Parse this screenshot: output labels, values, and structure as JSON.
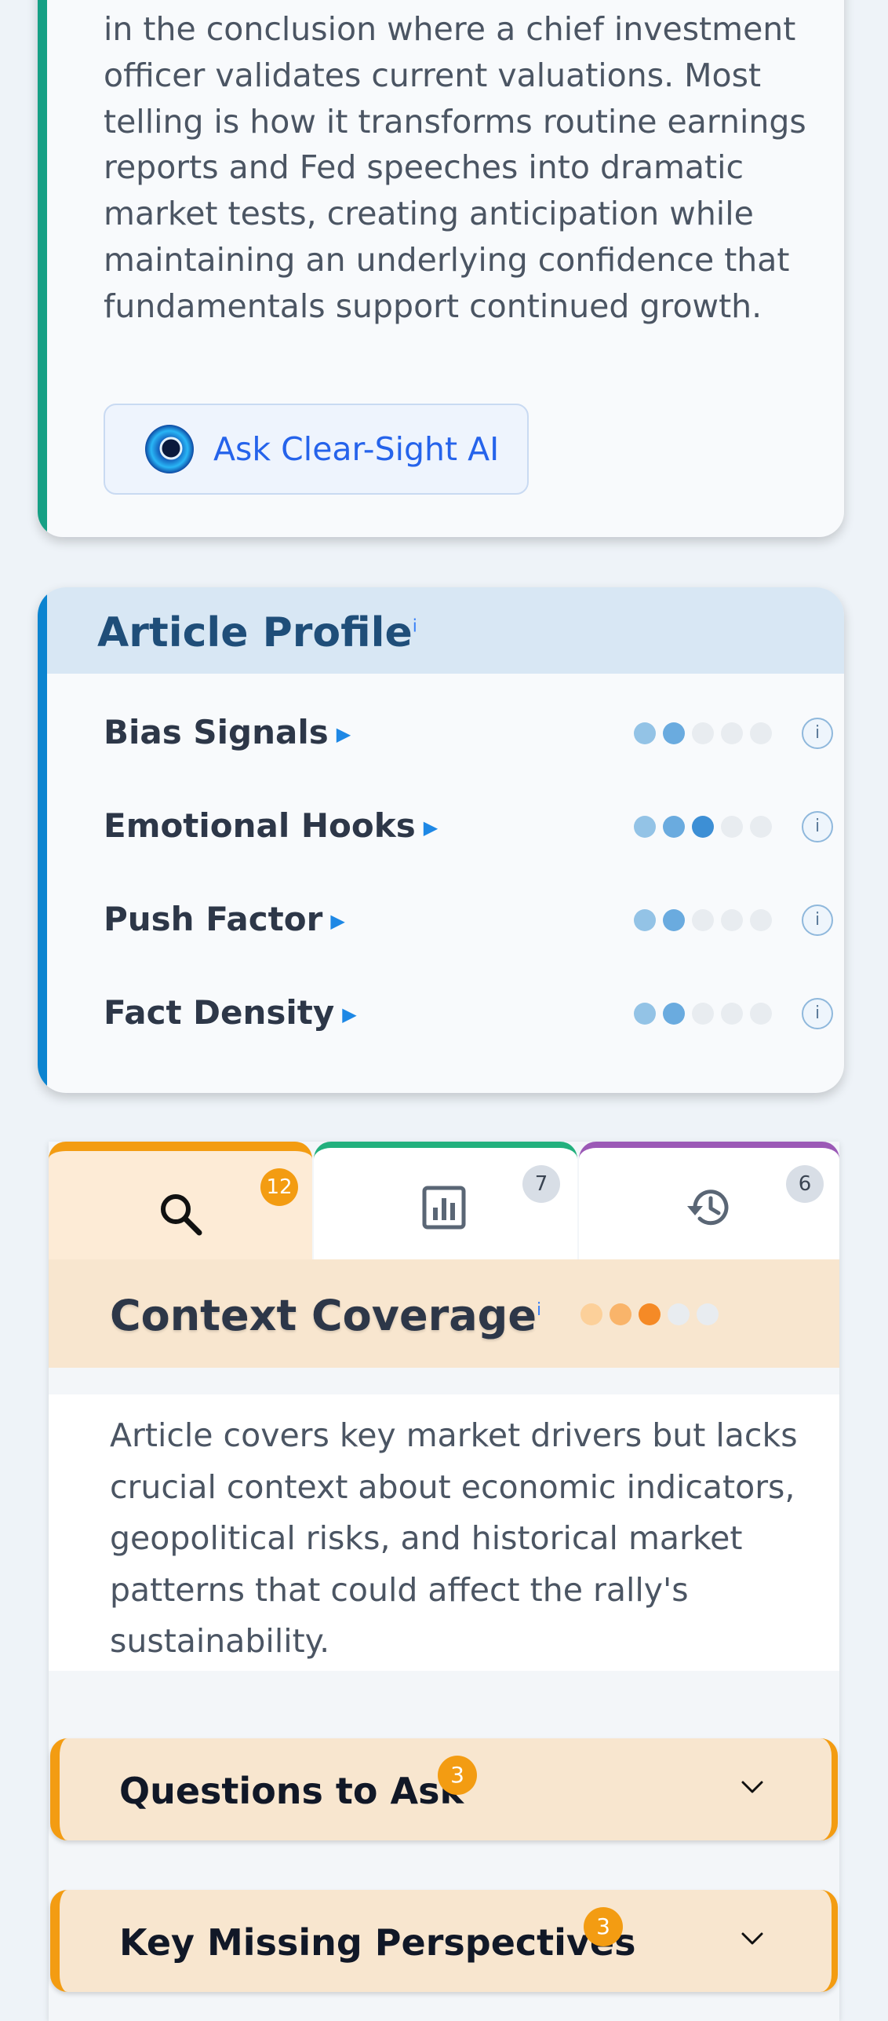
{
  "summary": {
    "paragraph": "in the conclusion where a chief investment officer validates current valuations. Most telling is how it transforms routine earnings reports and Fed speeches into dramatic market tests, creating anticipation while maintaining an underlying confidence that fundamentals support continued growth.",
    "ask_button_label": "Ask Clear-Sight AI",
    "accent_color": "#16a085"
  },
  "profile": {
    "title": "Article Profile",
    "info_marker": "i",
    "accent_color": "#0b84d0",
    "rows": [
      {
        "label": "Bias Signals",
        "level": 2,
        "max": 5,
        "info": "i"
      },
      {
        "label": "Emotional Hooks",
        "level": 3,
        "max": 5,
        "info": "i"
      },
      {
        "label": "Push Factor",
        "level": 2,
        "max": 5,
        "info": "i"
      },
      {
        "label": "Fact Density",
        "level": 2,
        "max": 5,
        "info": "i"
      }
    ]
  },
  "tabs": [
    {
      "icon": "search-icon",
      "count": "12",
      "accent": "#f39c12",
      "active": true
    },
    {
      "icon": "bar-chart-icon",
      "count": "7",
      "accent": "#22b07d",
      "active": false
    },
    {
      "icon": "history-icon",
      "count": "6",
      "accent": "#9b59b6",
      "active": false
    }
  ],
  "context": {
    "title": "Context Coverage",
    "info_marker": "i",
    "level": 3,
    "max": 5,
    "description": "Article covers key market drivers but lacks crucial context about economic indicators, geopolitical risks, and historical market patterns that could affect the rally's sustainability."
  },
  "sections": [
    {
      "label": "Questions to Ask",
      "count": "3"
    },
    {
      "label": "Key Missing Perspectives",
      "count": "3"
    }
  ]
}
